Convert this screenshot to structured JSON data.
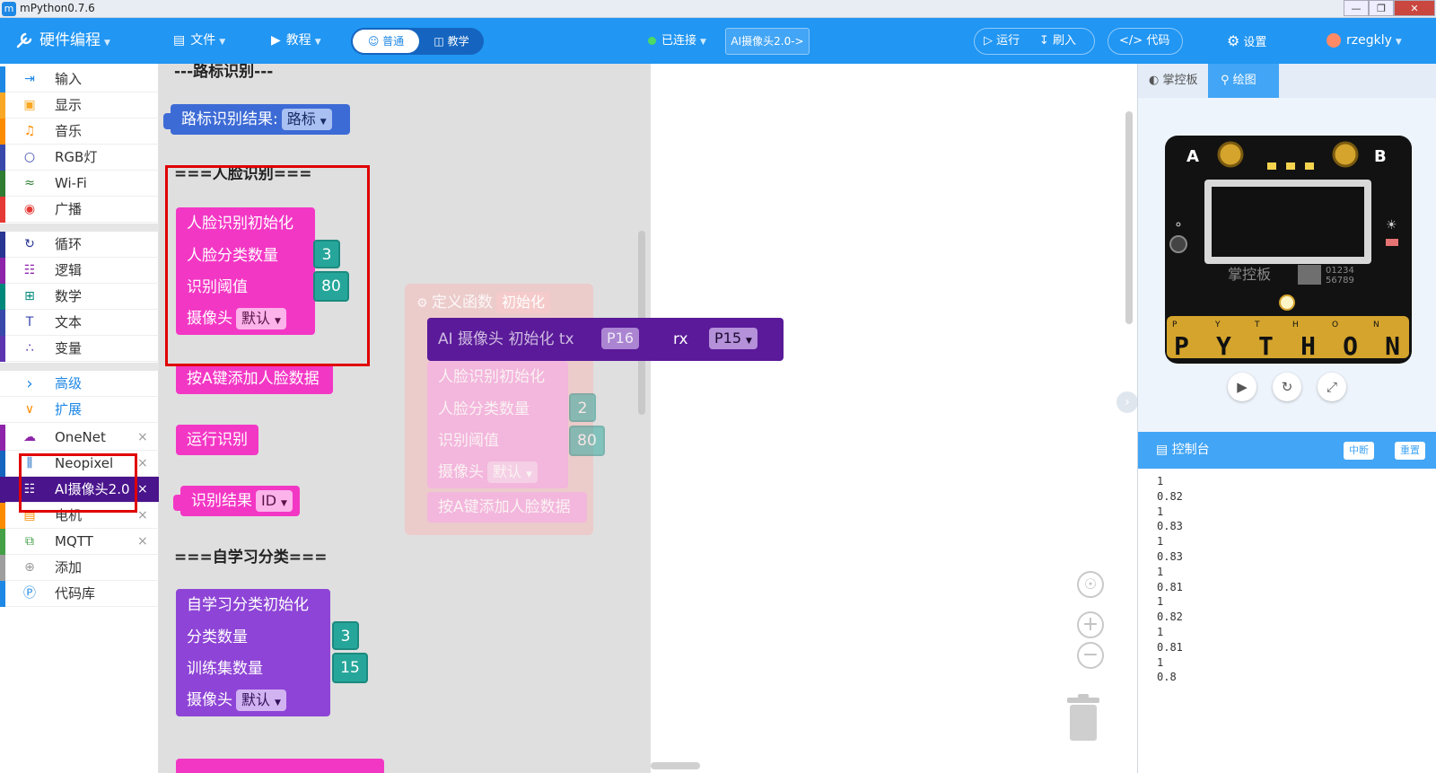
{
  "window": {
    "title": "mPython0.7.6",
    "app_icon": "m",
    "min": "—",
    "restore": "❐",
    "close": "✕"
  },
  "topbar": {
    "brand": "硬件编程",
    "file": "文件",
    "tutorial": "教程",
    "mode_normal": "普通",
    "mode_teach": "教学",
    "status": "已连接",
    "device": "AI摄像头2.0->",
    "run": "运行",
    "flash": "刷入",
    "code": "代码",
    "settings": "设置",
    "user": "rzegkly"
  },
  "sidebar": {
    "items": [
      {
        "label": "输入",
        "icon": "⇥",
        "color": "#1e88e5"
      },
      {
        "label": "显示",
        "icon": "▣",
        "color": "#f9a825"
      },
      {
        "label": "音乐",
        "icon": "♫",
        "color": "#fb8c00"
      },
      {
        "label": "RGB灯",
        "icon": "○",
        "color": "#3949ab"
      },
      {
        "label": "Wi-Fi",
        "icon": "≈",
        "color": "#2e7d32"
      },
      {
        "label": "广播",
        "icon": "◉",
        "color": "#e53935"
      },
      {
        "label": "循环",
        "icon": "↻",
        "color": "#283593"
      },
      {
        "label": "逻辑",
        "icon": "☷",
        "color": "#8e24aa"
      },
      {
        "label": "数学",
        "icon": "⊞",
        "color": "#00897b"
      },
      {
        "label": "文本",
        "icon": "T",
        "color": "#3949ab"
      },
      {
        "label": "变量",
        "icon": "∴",
        "color": "#5e35b1"
      },
      {
        "label": "高级",
        "icon": "›"
      },
      {
        "label": "扩展",
        "icon": "∨"
      },
      {
        "label": "OneNet",
        "icon": "☁",
        "color": "#8e24aa",
        "close": "×"
      },
      {
        "label": "Neopixel",
        "icon": "⫼",
        "color": "#1565c0",
        "close": "×"
      },
      {
        "label": "AI摄像头2.0",
        "icon": "☷",
        "color": "#4a148c",
        "close": "×"
      },
      {
        "label": "电机",
        "icon": "▤",
        "color": "#fb8c00",
        "close": "×"
      },
      {
        "label": "MQTT",
        "icon": "⧉",
        "color": "#43a047",
        "close": "×"
      },
      {
        "label": "添加",
        "icon": "⊕",
        "color": "#999999"
      },
      {
        "label": "代码库",
        "icon": "Ⓟ",
        "color": "#1e88e5"
      }
    ]
  },
  "flyout": {
    "road_header": "---路标识别---",
    "road_result": "路标识别结果:",
    "road_option": "路标",
    "face_header": "===人脸识别===",
    "face_init": "人脸识别初始化",
    "face_count_label": "人脸分类数量",
    "face_count": "3",
    "face_threshold_label": "识别阈值",
    "face_threshold": "80",
    "camera_label": "摄像头",
    "camera_option": "默认",
    "add_face": "按A键添加人脸数据",
    "run_recog": "运行识别",
    "result_label": "识别结果",
    "result_option": "ID",
    "self_header": "===自学习分类===",
    "self_init": "自学习分类初始化",
    "class_count_label": "分类数量",
    "class_count": "3",
    "train_count_label": "训练集数量",
    "train_count": "15"
  },
  "workspace": {
    "func_label": "定义函数",
    "func_name": "初始化",
    "cam_init": "AI 摄像头 初始化 tx",
    "tx": "P16",
    "rx_label": "rx",
    "rx": "P15",
    "g_face_init": "人脸识别初始化",
    "g_face_count_label": "人脸分类数量",
    "g_face_count": "2",
    "g_threshold_label": "识别阈值",
    "g_threshold": "80",
    "g_camera_label": "摄像头",
    "g_camera_option": "默认",
    "g_add_face": "按A键添加人脸数据"
  },
  "panel": {
    "tab_board": "掌控板",
    "tab_draw": "绘图",
    "board": {
      "label_a": "A",
      "label_b": "B",
      "brand": "掌控板",
      "qr_digits_1": "01234",
      "qr_digits_2": "56789",
      "pins": [
        "P",
        "Y",
        "T",
        "H",
        "O",
        "N"
      ],
      "logo": "PYTHON"
    },
    "console_title": "控制台",
    "interrupt": "中断",
    "reset": "重置",
    "output": [
      "1",
      "0.82",
      "1",
      "0.83",
      "1",
      "0.83",
      "1",
      "0.81",
      "1",
      "0.82",
      "1",
      "0.81",
      "1",
      "0.8"
    ]
  }
}
